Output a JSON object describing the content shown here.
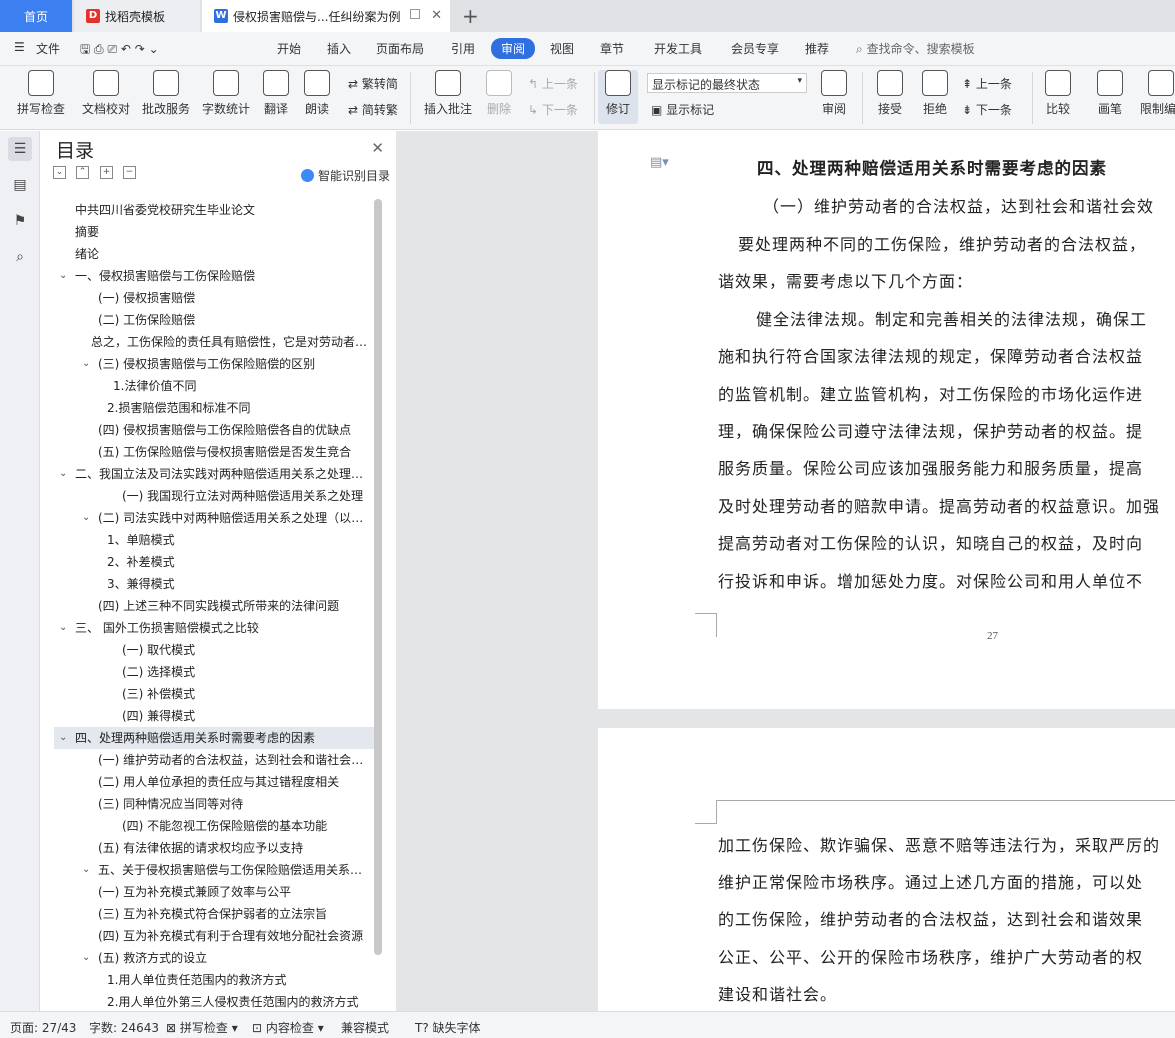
{
  "tabs": {
    "home": "首页",
    "template": "找稻壳模板",
    "doc": "侵权损害赔偿与...任纠纷案为例"
  },
  "menu": {
    "file": "文件",
    "items": [
      "开始",
      "插入",
      "页面布局",
      "引用",
      "审阅",
      "视图",
      "章节",
      "开发工具",
      "会员专享",
      "推荐"
    ],
    "search": "查找命令、搜索模板"
  },
  "ribbon": {
    "spell": "拼写检查",
    "proof": "文档校对",
    "annot": "批改服务",
    "wordcount": "字数统计",
    "translate": "翻译",
    "read": "朗读",
    "trad": "繁转简",
    "simp": "简转繁",
    "insert_comment": "插入批注",
    "delete": "删除",
    "prev": "上一条",
    "next": "下一条",
    "revise": "修订",
    "track_state": "显示标记的最终状态",
    "show_marks": "显示标记",
    "review": "审阅",
    "accept": "接受",
    "reject": "拒绝",
    "prev2": "上一条",
    "next2": "下一条",
    "compare": "比较",
    "pen": "画笔",
    "restrict": "限制编"
  },
  "nav": {
    "title": "目录",
    "smart": "智能识别目录",
    "items": [
      "中共四川省委党校研究生毕业论文",
      "摘要",
      "绪论",
      "一、侵权损害赔偿与工伤保险赔偿",
      "(一) 侵权损害赔偿",
      "(二) 工伤保险赔偿",
      "总之，工伤保险的责任具有赔偿性，它是对劳动者的损害赔偿",
      "(三) 侵权损害赔偿与工伤保险赔偿的区别",
      "1.法律价值不同",
      "2.损害赔偿范围和标准不同",
      "(四) 侵权损害赔偿与工伤保险赔偿各自的优缺点",
      "(五) 工伤保险赔偿与侵权损害赔偿是否发生竞合",
      "二、我国立法及司法实践对两种赔偿适用关系之处理方式",
      "(一) 我国现行立法对两种赔偿适用关系之处理",
      "(二) 司法实践中对两种赔偿适用关系之处理（以案例为例）",
      "1、单赔模式",
      "2、补差模式",
      "3、兼得模式",
      "(四) 上述三种不同实践模式所带来的法律问题",
      "三、 国外工伤损害赔偿模式之比较",
      "(一) 取代模式",
      "(二) 选择模式",
      "(三) 补偿模式",
      "(四) 兼得模式",
      "四、处理两种赔偿适用关系时需要考虑的因素",
      "(一) 维护劳动者的合法权益，达到社会和谐社会效果",
      "(二) 用人单位承担的责任应与其过错程度相关",
      "(三) 同种情况应当同等对待",
      "(四) 不能忽视工伤保险赔偿的基本功能",
      "(五) 有法律依据的请求权均应予以支持",
      "五、关于侵权损害赔偿与工伤保险赔偿适用关系的建议",
      "(一) 互为补充模式兼顾了效率与公平",
      "(三) 互为补充模式符合保护弱者的立法宗旨",
      "(四) 互为补充模式有利于合理有效地分配社会资源",
      "(五) 救济方式的设立",
      "1.用人单位责任范围内的救济方式",
      "2.用人单位外第三人侵权责任范围内的救济方式"
    ]
  },
  "doc": {
    "p1": [
      "四、处理两种赔偿适用关系时需要考虑的因素",
      "（一）维护劳动者的合法权益，达到社会和谐社会效",
      "要处理两种不同的工伤保险，维护劳动者的合法权益，",
      "谐效果，需要考虑以下几个方面：",
      "健全法律法规。制定和完善相关的法律法规，确保工",
      "施和执行符合国家法律法规的规定，保障劳动者合法权益",
      "的监管机制。建立监管机构，对工伤保险的市场化运作进",
      "理，确保保险公司遵守法律法规，保护劳动者的权益。提",
      "服务质量。保险公司应该加强服务能力和服务质量，提高",
      "及时处理劳动者的赔款申请。提高劳动者的权益意识。加强",
      "提高劳动者对工伤保险的认识，知晓自己的权益，及时向",
      "行投诉和申诉。增加惩处力度。对保险公司和用人单位不"
    ],
    "page_num": "27",
    "p2": [
      "加工伤保险、欺诈骗保、恶意不赔等违法行为，采取严厉的",
      "维护正常保险市场秩序。通过上述几方面的措施，可以处",
      "的工伤保险，维护劳动者的合法权益，达到社会和谐效果",
      "公正、公平、公开的保险市场秩序，维护广大劳动者的权",
      "建设和谐社会。"
    ]
  },
  "status": {
    "page": "页面: 27/43",
    "words": "字数: 24643",
    "spell": "拼写检查",
    "content": "内容检查",
    "compat": "兼容模式",
    "font": "缺失字体"
  }
}
